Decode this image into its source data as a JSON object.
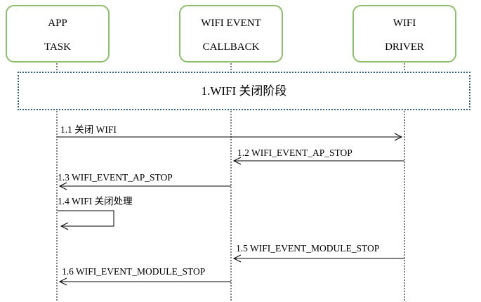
{
  "participants": [
    {
      "id": "app",
      "line1": "APP",
      "line2": "TASK"
    },
    {
      "id": "callback",
      "line1": "WIFI EVENT",
      "line2": "CALLBACK"
    },
    {
      "id": "driver",
      "line1": "WIFI",
      "line2": "DRIVER"
    }
  ],
  "phase": {
    "label": "1.WIFI 关闭阶段"
  },
  "messages": [
    {
      "label": "1.1  关闭 WIFI",
      "from": "app",
      "to": "driver"
    },
    {
      "label": "1.2  WIFI_EVENT_AP_STOP",
      "from": "driver",
      "to": "callback"
    },
    {
      "label": "1.3  WIFI_EVENT_AP_STOP",
      "from": "callback",
      "to": "app"
    },
    {
      "label": "1.4  WIFI 关闭处理",
      "from": "app",
      "to": "app"
    },
    {
      "label": "1.5  WIFI_EVENT_MODULE_STOP",
      "from": "driver",
      "to": "callback"
    },
    {
      "label": "1.6  WIFI_EVENT_MODULE_STOP",
      "from": "callback",
      "to": "app"
    }
  ],
  "colors": {
    "box_border": "#8cc068",
    "phase_border": "#2f5f86",
    "line": "#000000"
  }
}
